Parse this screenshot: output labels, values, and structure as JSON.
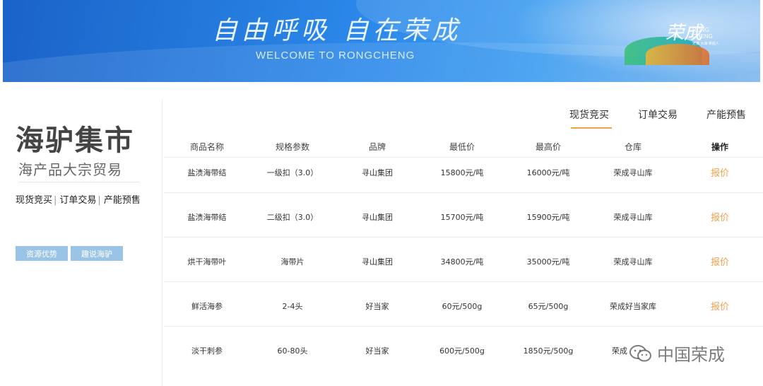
{
  "banner": {
    "title": "自由呼吸 自在荣成",
    "subtitle": "WELCOME TO RONGCHENG",
    "logo_mark": "荣成",
    "logo_en_1": "RONG",
    "logo_en_2": "CHENG",
    "logo_slogan": "无畏 大海 荣成人"
  },
  "sidebar": {
    "brand": "海驴集市",
    "tagline": "海产品大宗贸易",
    "links": [
      "现货竞买",
      "订单交易",
      "产能预售"
    ],
    "buttons": [
      "资源优势",
      "趣说海驴"
    ]
  },
  "tabs": [
    "现货竞买",
    "订单交易",
    "产能预售"
  ],
  "active_tab": "现货竞买",
  "table": {
    "columns": [
      "商品名称",
      "规格参数",
      "品牌",
      "最低价",
      "最高价",
      "仓库",
      "操作"
    ],
    "rows": [
      {
        "name": "盐渍海带结",
        "spec": "一级扣（3.0）",
        "brand": "寻山集团",
        "min": "15800元/吨",
        "max": "16000元/吨",
        "warehouse": "荣成寻山库",
        "action": "报价"
      },
      {
        "name": "盐渍海带结",
        "spec": "二级扣（3.0）",
        "brand": "寻山集团",
        "min": "15700元/吨",
        "max": "15900元/吨",
        "warehouse": "荣成寻山库",
        "action": "报价"
      },
      {
        "name": "烘干海带叶",
        "spec": "海带片",
        "brand": "寻山集团",
        "min": "34800元/吨",
        "max": "35000元/吨",
        "warehouse": "荣成寻山库",
        "action": "报价"
      },
      {
        "name": "鲜活海参",
        "spec": "2-4头",
        "brand": "好当家",
        "min": "60元/500g",
        "max": "65元/500g",
        "warehouse": "荣成好当家库",
        "action": "报价"
      },
      {
        "name": "淡干刺参",
        "spec": "60-80头",
        "brand": "好当家",
        "min": "600元/500g",
        "max": "1850元/500g",
        "warehouse": "荣成",
        "action": ""
      }
    ]
  },
  "watermark": "中国荣成",
  "colors": {
    "banner_blue": "#2a86e8",
    "accent_orange": "#f0a448",
    "button_blue": "#99c4e6"
  }
}
